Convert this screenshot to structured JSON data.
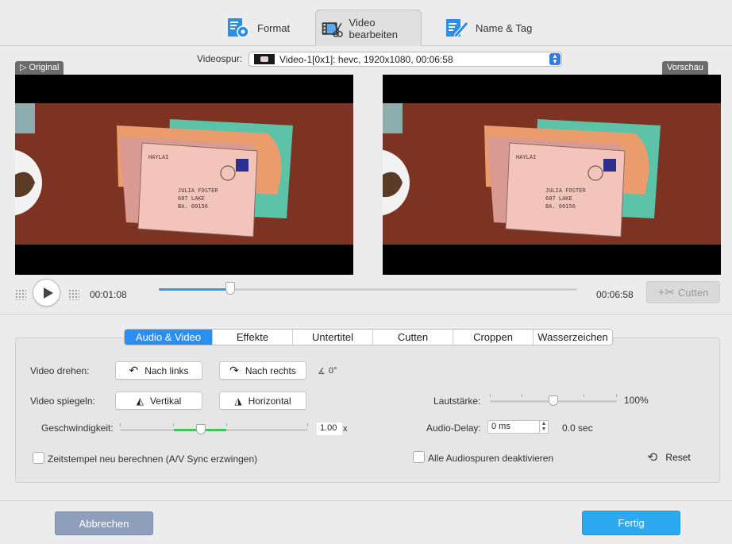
{
  "toolbar": {
    "tabs": [
      {
        "label": "Format",
        "icon": "format-settings-icon"
      },
      {
        "label": "Video bearbeiten",
        "icon": "video-edit-icon"
      },
      {
        "label": "Name & Tag",
        "icon": "name-tag-icon"
      }
    ],
    "active_tab": "Video bearbeiten"
  },
  "track": {
    "label": "Videospur:",
    "value": "Video-1[0x1]: hevc, 1920x1080, 00:06:58"
  },
  "preview": {
    "original_label": "Original",
    "preview_label": "Vorschau",
    "current_time": "00:01:08",
    "total_time": "00:06:58",
    "progress": 0.17,
    "cut_label": "Cutten"
  },
  "tabs": [
    "Audio & Video",
    "Effekte",
    "Untertitel",
    "Cutten",
    "Croppen",
    "Wasserzeichen"
  ],
  "active_tab": "Audio & Video",
  "audio_video": {
    "rotate_label": "Video drehen:",
    "rotate_left": "Nach links",
    "rotate_right": "Nach rechts",
    "rotation_value": "0°",
    "mirror_label": "Video spiegeln:",
    "mirror_vertical": "Vertikal",
    "mirror_horizontal": "Horizontal",
    "speed_label": "Geschwindigkeit:",
    "speed_value": "1.00",
    "speed_unit": "x",
    "speed_level": 0.5,
    "volume_label": "Lautstärke:",
    "volume_value": "100%",
    "volume_level": 0.5,
    "audio_delay_label": "Audio-Delay:",
    "audio_delay_value": "0 ms",
    "audio_delay_seconds": "0.0 sec",
    "timestamp_checkbox": "Zeitstempel neu berechnen (A/V Sync erzwingen)",
    "timestamp_checked": false,
    "disable_audio_checkbox": "Alle Audiospuren deaktivieren",
    "disable_audio_checked": false,
    "reset_label": "Reset"
  },
  "footer": {
    "cancel_label": "Abbrechen",
    "done_label": "Fertig"
  },
  "colors": {
    "accent": "#2b8ef3",
    "done": "#2baaf2",
    "cancel": "#8e9fbc",
    "seek": "#2d9bef",
    "speed_range": "#41c35f"
  }
}
